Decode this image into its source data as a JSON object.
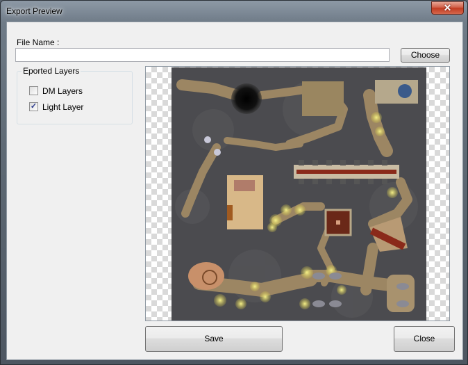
{
  "window": {
    "title": "Export Preview",
    "close_glyph": "✕"
  },
  "file": {
    "label": "File Name :",
    "value": "",
    "placeholder": ""
  },
  "buttons": {
    "choose": "Choose",
    "save": "Save",
    "close": "Close"
  },
  "layers": {
    "legend": "Eported Layers",
    "items": [
      {
        "label": "DM Layers",
        "checked": false
      },
      {
        "label": "Light Layer",
        "checked": true
      }
    ]
  },
  "colors": {
    "window_bg": "#f0f0f0",
    "close_button": "#c23b20",
    "rock": "#4a4a4e",
    "path": "#a08a66",
    "light": "#e8e060"
  }
}
